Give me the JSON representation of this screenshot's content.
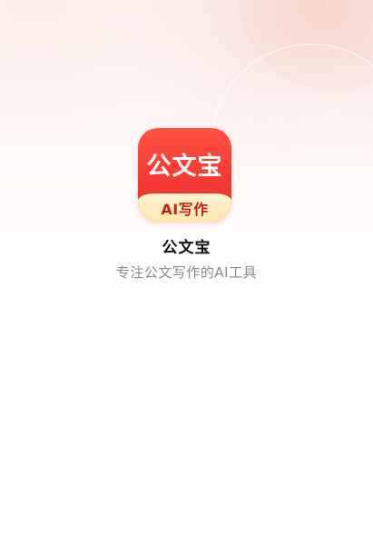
{
  "app_icon": {
    "title": "公文宝",
    "tagline": "AI写作"
  },
  "app_name": "公文宝",
  "slogan": "专注公文写作的AI工具",
  "colors": {
    "icon_red": "#f43a33",
    "icon_band": "#ffe7ad",
    "tagline_text": "#c2221e",
    "name_text": "#111111",
    "slogan_text": "#8a8a8a",
    "background_tint": "#fbe8e4"
  }
}
